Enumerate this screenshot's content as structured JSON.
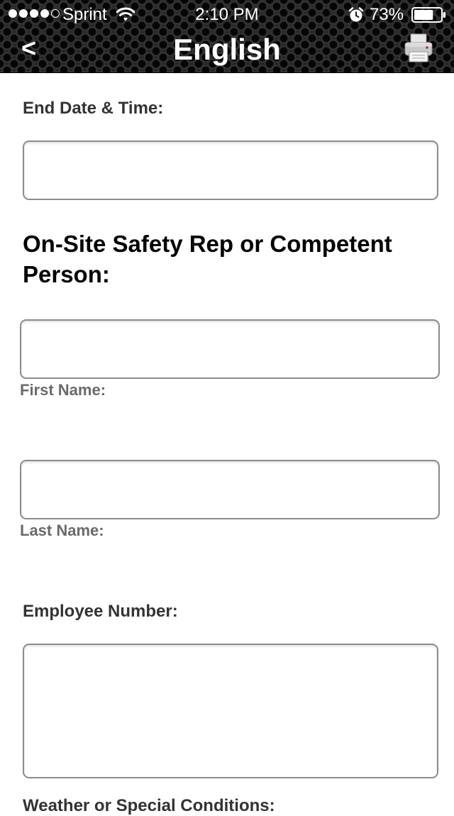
{
  "status_bar": {
    "carrier": "Sprint",
    "time": "2:10 PM",
    "battery_percent": "73%",
    "signal_bars_filled": 4,
    "battery_level": 0.73,
    "icons": [
      "signal-dots",
      "wifi-icon",
      "alarm-icon",
      "battery-icon"
    ]
  },
  "nav": {
    "back_label": "<",
    "title": "English",
    "print_icon": "printer-icon"
  },
  "form": {
    "end_datetime": {
      "label": "End Date & Time:",
      "value": ""
    },
    "safety_rep_heading": "On-Site Safety Rep or Competent Person:",
    "first_name": {
      "value": "",
      "sublabel": "First Name:"
    },
    "last_name": {
      "value": "",
      "sublabel": "Last Name:"
    },
    "employee_number": {
      "label": "Employee Number:",
      "value": ""
    },
    "weather": {
      "label": "Weather or Special Conditions:"
    }
  },
  "colors": {
    "header_bg": "#1b1b1b",
    "header_text": "#ffffff",
    "label_text": "#333333",
    "sublabel_text": "#6a6a6a",
    "field_border": "#8c8c8c"
  }
}
